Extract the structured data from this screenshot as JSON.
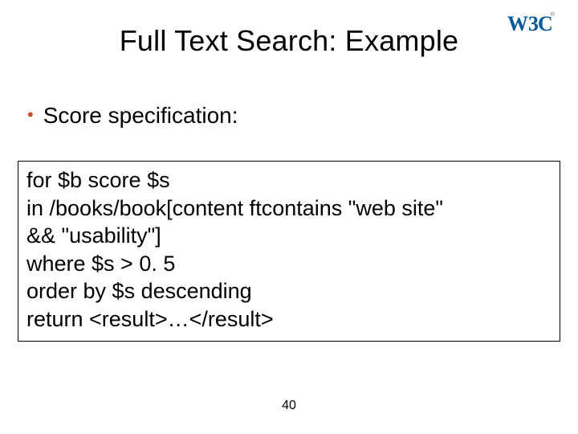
{
  "title": "Full Text Search: Example",
  "bullet": "Score specification:",
  "code": "for $b score $s\nin /books/book[content ftcontains \"web site\"\n&& \"usability\"]\nwhere $s > 0. 5\norder by $s descending\nreturn <result>…</result>",
  "page_number": "40",
  "logo_text": "W3C"
}
